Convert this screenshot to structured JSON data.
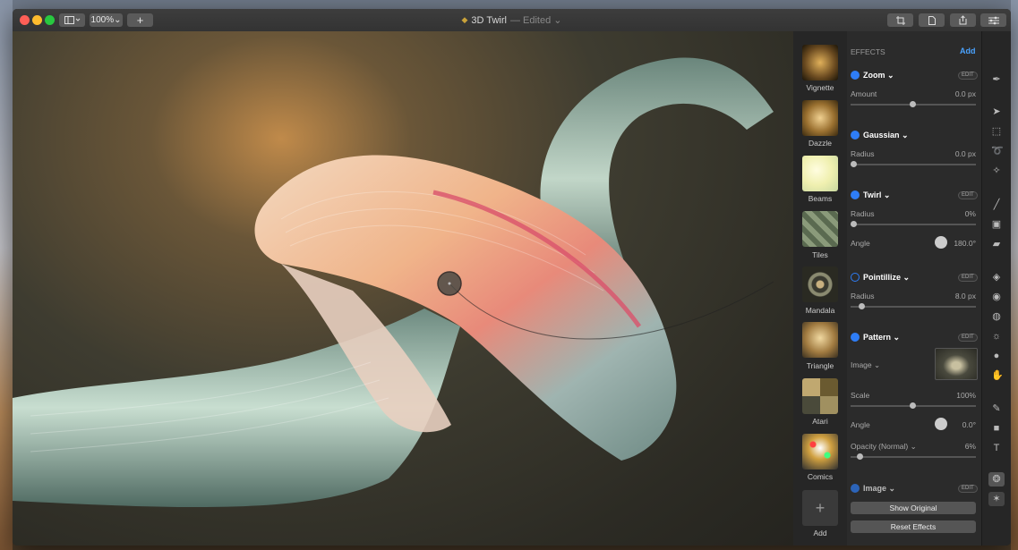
{
  "window": {
    "title": "3D Twirl",
    "edited": "— Edited ⌄",
    "zoom": "100%⌄",
    "add_symbol": "+"
  },
  "thumbnails": [
    {
      "label": "Vignette"
    },
    {
      "label": "Dazzle"
    },
    {
      "label": "Beams"
    },
    {
      "label": "Tiles"
    },
    {
      "label": "Mandala"
    },
    {
      "label": "Triangle"
    },
    {
      "label": "Atari"
    },
    {
      "label": "Comics"
    },
    {
      "label": "Add"
    }
  ],
  "panel": {
    "header": "EFFECTS",
    "add_label": "Add",
    "edit_label": "EDIT",
    "effects": {
      "zoom": {
        "name": "Zoom",
        "amount_label": "Amount",
        "amount_value": "0.0 px",
        "amount_level": 0.5
      },
      "gaussian": {
        "name": "Gaussian",
        "radius_label": "Radius",
        "radius_value": "0.0 px",
        "radius_level": 0.0
      },
      "twirl": {
        "name": "Twirl",
        "radius_label": "Radius",
        "radius_value": "0%",
        "radius_level": 0.0,
        "angle_label": "Angle",
        "angle_value": "180.0°"
      },
      "pointillize": {
        "name": "Pointillize",
        "radius_label": "Radius",
        "radius_value": "8.0 px",
        "radius_level": 0.08
      },
      "pattern": {
        "name": "Pattern",
        "image_label": "Image ⌄",
        "scale_label": "Scale",
        "scale_value": "100%",
        "scale_level": 0.5,
        "angle_label": "Angle",
        "angle_value": "0.0°",
        "opacity_label": "Opacity (Normal) ⌄",
        "opacity_value": "6%",
        "opacity_level": 0.06
      },
      "image": {
        "name": "Image"
      }
    },
    "show_original": "Show Original",
    "reset_effects": "Reset Effects"
  },
  "tools": [
    "pen-nib-icon",
    "arrow-icon",
    "marquee-icon",
    "lasso-icon",
    "magic-wand-icon",
    "brush-icon",
    "bucket-icon",
    "eraser-icon",
    "bandage-icon",
    "clone-icon",
    "blur-icon",
    "sun-icon",
    "smudge-icon",
    "hand-icon",
    "pen-icon",
    "shape-icon",
    "text-icon",
    "effects-icon",
    "star-icon"
  ],
  "colors": {
    "accent": "#2e7df6",
    "add_link": "#4aa3ff"
  }
}
